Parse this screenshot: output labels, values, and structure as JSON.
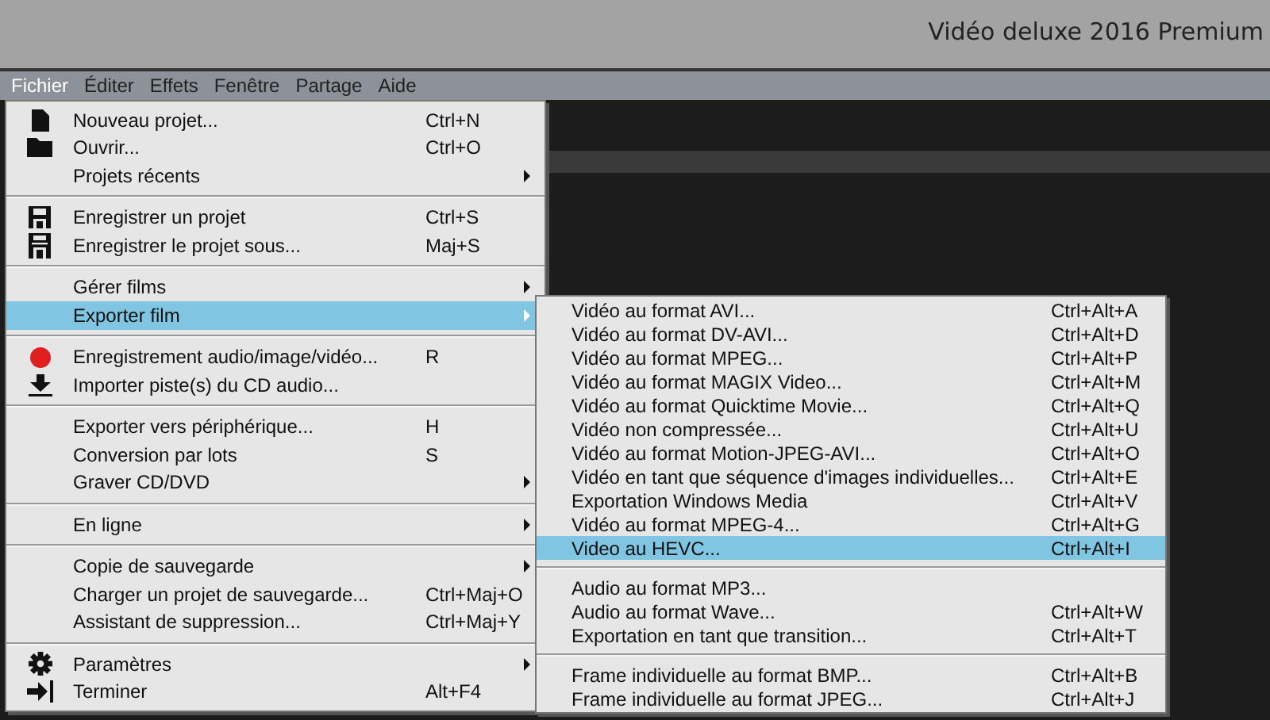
{
  "window": {
    "title": "Vidéo deluxe 2016 Premium"
  },
  "menubar": [
    {
      "label": "Fichier",
      "selected": true
    },
    {
      "label": "Éditer",
      "selected": false
    },
    {
      "label": "Effets",
      "selected": false
    },
    {
      "label": "Fenêtre",
      "selected": false
    },
    {
      "label": "Partage",
      "selected": false
    },
    {
      "label": "Aide",
      "selected": false
    }
  ],
  "file_menu": [
    {
      "kind": "item",
      "label": "Nouveau projet...",
      "shortcut": "Ctrl+N",
      "submenu": false,
      "selected": false
    },
    {
      "kind": "item",
      "label": "Ouvrir...",
      "shortcut": "Ctrl+O",
      "submenu": false,
      "selected": false
    },
    {
      "kind": "item",
      "label": "Projets récents",
      "submenu": true,
      "selected": false
    },
    {
      "kind": "separator"
    },
    {
      "kind": "item",
      "label": "Enregistrer un projet",
      "shortcut": "Ctrl+S",
      "submenu": false,
      "selected": false
    },
    {
      "kind": "item",
      "label": "Enregistrer le projet sous...",
      "shortcut": "Maj+S",
      "submenu": false,
      "selected": false
    },
    {
      "kind": "separator"
    },
    {
      "kind": "item",
      "label": "Gérer films",
      "submenu": true,
      "selected": false
    },
    {
      "kind": "item",
      "label": "Exporter film",
      "submenu": true,
      "selected": true
    },
    {
      "kind": "separator"
    },
    {
      "kind": "item",
      "label": "Enregistrement audio/image/vidéo...",
      "shortcut": "R",
      "submenu": false,
      "selected": false
    },
    {
      "kind": "item",
      "label": "Importer piste(s) du CD audio...",
      "submenu": false,
      "selected": false
    },
    {
      "kind": "separator"
    },
    {
      "kind": "item",
      "label": "Exporter vers périphérique...",
      "shortcut": "H",
      "submenu": false,
      "selected": false
    },
    {
      "kind": "item",
      "label": "Conversion par lots",
      "shortcut": "S",
      "submenu": false,
      "selected": false
    },
    {
      "kind": "item",
      "label": "Graver CD/DVD",
      "submenu": true,
      "selected": false
    },
    {
      "kind": "separator"
    },
    {
      "kind": "item",
      "label": "En ligne",
      "submenu": true,
      "selected": false
    },
    {
      "kind": "separator"
    },
    {
      "kind": "item",
      "label": "Copie de sauvegarde",
      "submenu": true,
      "selected": false
    },
    {
      "kind": "item",
      "label": "Charger un projet de sauvegarde...",
      "shortcut": "Ctrl+Maj+O",
      "submenu": false,
      "selected": false
    },
    {
      "kind": "item",
      "label": "Assistant de suppression...",
      "shortcut": "Ctrl+Maj+Y",
      "submenu": false,
      "selected": false
    },
    {
      "kind": "separator"
    },
    {
      "kind": "item",
      "label": "Paramètres",
      "submenu": true,
      "selected": false
    },
    {
      "kind": "item",
      "label": "Terminer",
      "shortcut": "Alt+F4",
      "submenu": false,
      "selected": false
    }
  ],
  "export_submenu": [
    {
      "kind": "item",
      "label": "Vidéo au format AVI...",
      "shortcut": "Ctrl+Alt+A",
      "selected": false
    },
    {
      "kind": "item",
      "label": "Vidéo au format DV-AVI...",
      "shortcut": "Ctrl+Alt+D",
      "selected": false
    },
    {
      "kind": "item",
      "label": "Vidéo au format MPEG...",
      "shortcut": "Ctrl+Alt+P",
      "selected": false
    },
    {
      "kind": "item",
      "label": "Vidéo au format MAGIX Video...",
      "shortcut": "Ctrl+Alt+M",
      "selected": false
    },
    {
      "kind": "item",
      "label": "Vidéo au format Quicktime Movie...",
      "shortcut": "Ctrl+Alt+Q",
      "selected": false
    },
    {
      "kind": "item",
      "label": "Vidéo non compressée...",
      "shortcut": "Ctrl+Alt+U",
      "selected": false
    },
    {
      "kind": "item",
      "label": "Vidéo au format Motion-JPEG-AVI...",
      "shortcut": "Ctrl+Alt+O",
      "selected": false
    },
    {
      "kind": "item",
      "label": "Vidéo en tant que séquence d'images individuelles...",
      "shortcut": "Ctrl+Alt+E",
      "selected": false
    },
    {
      "kind": "item",
      "label": "Exportation Windows Media",
      "shortcut": "Ctrl+Alt+V",
      "selected": false
    },
    {
      "kind": "item",
      "label": "Vidéo au format MPEG-4...",
      "shortcut": "Ctrl+Alt+G",
      "selected": false
    },
    {
      "kind": "item",
      "label": "Video au HEVC...",
      "shortcut": "Ctrl+Alt+I",
      "selected": true
    },
    {
      "kind": "separator"
    },
    {
      "kind": "item",
      "label": "Audio au format MP3...",
      "selected": false
    },
    {
      "kind": "item",
      "label": "Audio au format Wave...",
      "shortcut": "Ctrl+Alt+W",
      "selected": false
    },
    {
      "kind": "item",
      "label": "Exportation en tant que transition...",
      "shortcut": "Ctrl+Alt+T",
      "selected": false
    },
    {
      "kind": "separator"
    },
    {
      "kind": "item",
      "label": "Frame individuelle au format BMP...",
      "shortcut": "Ctrl+Alt+B",
      "selected": false
    },
    {
      "kind": "item",
      "label": "Frame individuelle au format JPEG...",
      "shortcut": "Ctrl+Alt+J",
      "selected": false
    }
  ]
}
